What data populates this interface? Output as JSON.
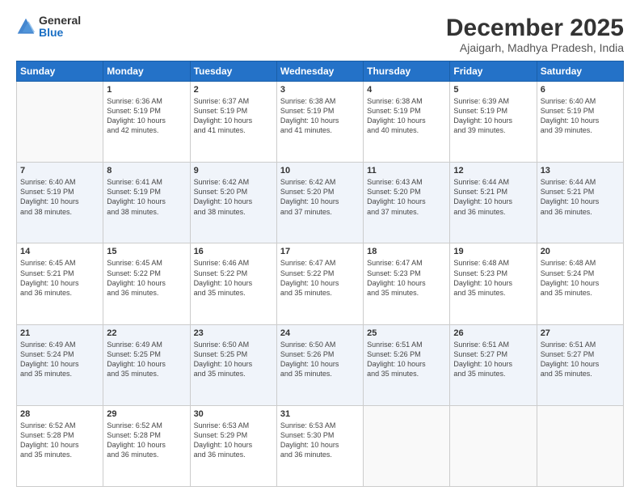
{
  "logo": {
    "general": "General",
    "blue": "Blue"
  },
  "header": {
    "month": "December 2025",
    "location": "Ajaigarh, Madhya Pradesh, India"
  },
  "weekdays": [
    "Sunday",
    "Monday",
    "Tuesday",
    "Wednesday",
    "Thursday",
    "Friday",
    "Saturday"
  ],
  "weeks": [
    [
      {
        "day": "",
        "info": ""
      },
      {
        "day": "1",
        "info": "Sunrise: 6:36 AM\nSunset: 5:19 PM\nDaylight: 10 hours\nand 42 minutes."
      },
      {
        "day": "2",
        "info": "Sunrise: 6:37 AM\nSunset: 5:19 PM\nDaylight: 10 hours\nand 41 minutes."
      },
      {
        "day": "3",
        "info": "Sunrise: 6:38 AM\nSunset: 5:19 PM\nDaylight: 10 hours\nand 41 minutes."
      },
      {
        "day": "4",
        "info": "Sunrise: 6:38 AM\nSunset: 5:19 PM\nDaylight: 10 hours\nand 40 minutes."
      },
      {
        "day": "5",
        "info": "Sunrise: 6:39 AM\nSunset: 5:19 PM\nDaylight: 10 hours\nand 39 minutes."
      },
      {
        "day": "6",
        "info": "Sunrise: 6:40 AM\nSunset: 5:19 PM\nDaylight: 10 hours\nand 39 minutes."
      }
    ],
    [
      {
        "day": "7",
        "info": "Sunrise: 6:40 AM\nSunset: 5:19 PM\nDaylight: 10 hours\nand 38 minutes."
      },
      {
        "day": "8",
        "info": "Sunrise: 6:41 AM\nSunset: 5:19 PM\nDaylight: 10 hours\nand 38 minutes."
      },
      {
        "day": "9",
        "info": "Sunrise: 6:42 AM\nSunset: 5:20 PM\nDaylight: 10 hours\nand 38 minutes."
      },
      {
        "day": "10",
        "info": "Sunrise: 6:42 AM\nSunset: 5:20 PM\nDaylight: 10 hours\nand 37 minutes."
      },
      {
        "day": "11",
        "info": "Sunrise: 6:43 AM\nSunset: 5:20 PM\nDaylight: 10 hours\nand 37 minutes."
      },
      {
        "day": "12",
        "info": "Sunrise: 6:44 AM\nSunset: 5:21 PM\nDaylight: 10 hours\nand 36 minutes."
      },
      {
        "day": "13",
        "info": "Sunrise: 6:44 AM\nSunset: 5:21 PM\nDaylight: 10 hours\nand 36 minutes."
      }
    ],
    [
      {
        "day": "14",
        "info": "Sunrise: 6:45 AM\nSunset: 5:21 PM\nDaylight: 10 hours\nand 36 minutes."
      },
      {
        "day": "15",
        "info": "Sunrise: 6:45 AM\nSunset: 5:22 PM\nDaylight: 10 hours\nand 36 minutes."
      },
      {
        "day": "16",
        "info": "Sunrise: 6:46 AM\nSunset: 5:22 PM\nDaylight: 10 hours\nand 35 minutes."
      },
      {
        "day": "17",
        "info": "Sunrise: 6:47 AM\nSunset: 5:22 PM\nDaylight: 10 hours\nand 35 minutes."
      },
      {
        "day": "18",
        "info": "Sunrise: 6:47 AM\nSunset: 5:23 PM\nDaylight: 10 hours\nand 35 minutes."
      },
      {
        "day": "19",
        "info": "Sunrise: 6:48 AM\nSunset: 5:23 PM\nDaylight: 10 hours\nand 35 minutes."
      },
      {
        "day": "20",
        "info": "Sunrise: 6:48 AM\nSunset: 5:24 PM\nDaylight: 10 hours\nand 35 minutes."
      }
    ],
    [
      {
        "day": "21",
        "info": "Sunrise: 6:49 AM\nSunset: 5:24 PM\nDaylight: 10 hours\nand 35 minutes."
      },
      {
        "day": "22",
        "info": "Sunrise: 6:49 AM\nSunset: 5:25 PM\nDaylight: 10 hours\nand 35 minutes."
      },
      {
        "day": "23",
        "info": "Sunrise: 6:50 AM\nSunset: 5:25 PM\nDaylight: 10 hours\nand 35 minutes."
      },
      {
        "day": "24",
        "info": "Sunrise: 6:50 AM\nSunset: 5:26 PM\nDaylight: 10 hours\nand 35 minutes."
      },
      {
        "day": "25",
        "info": "Sunrise: 6:51 AM\nSunset: 5:26 PM\nDaylight: 10 hours\nand 35 minutes."
      },
      {
        "day": "26",
        "info": "Sunrise: 6:51 AM\nSunset: 5:27 PM\nDaylight: 10 hours\nand 35 minutes."
      },
      {
        "day": "27",
        "info": "Sunrise: 6:51 AM\nSunset: 5:27 PM\nDaylight: 10 hours\nand 35 minutes."
      }
    ],
    [
      {
        "day": "28",
        "info": "Sunrise: 6:52 AM\nSunset: 5:28 PM\nDaylight: 10 hours\nand 35 minutes."
      },
      {
        "day": "29",
        "info": "Sunrise: 6:52 AM\nSunset: 5:28 PM\nDaylight: 10 hours\nand 36 minutes."
      },
      {
        "day": "30",
        "info": "Sunrise: 6:53 AM\nSunset: 5:29 PM\nDaylight: 10 hours\nand 36 minutes."
      },
      {
        "day": "31",
        "info": "Sunrise: 6:53 AM\nSunset: 5:30 PM\nDaylight: 10 hours\nand 36 minutes."
      },
      {
        "day": "",
        "info": ""
      },
      {
        "day": "",
        "info": ""
      },
      {
        "day": "",
        "info": ""
      }
    ]
  ]
}
